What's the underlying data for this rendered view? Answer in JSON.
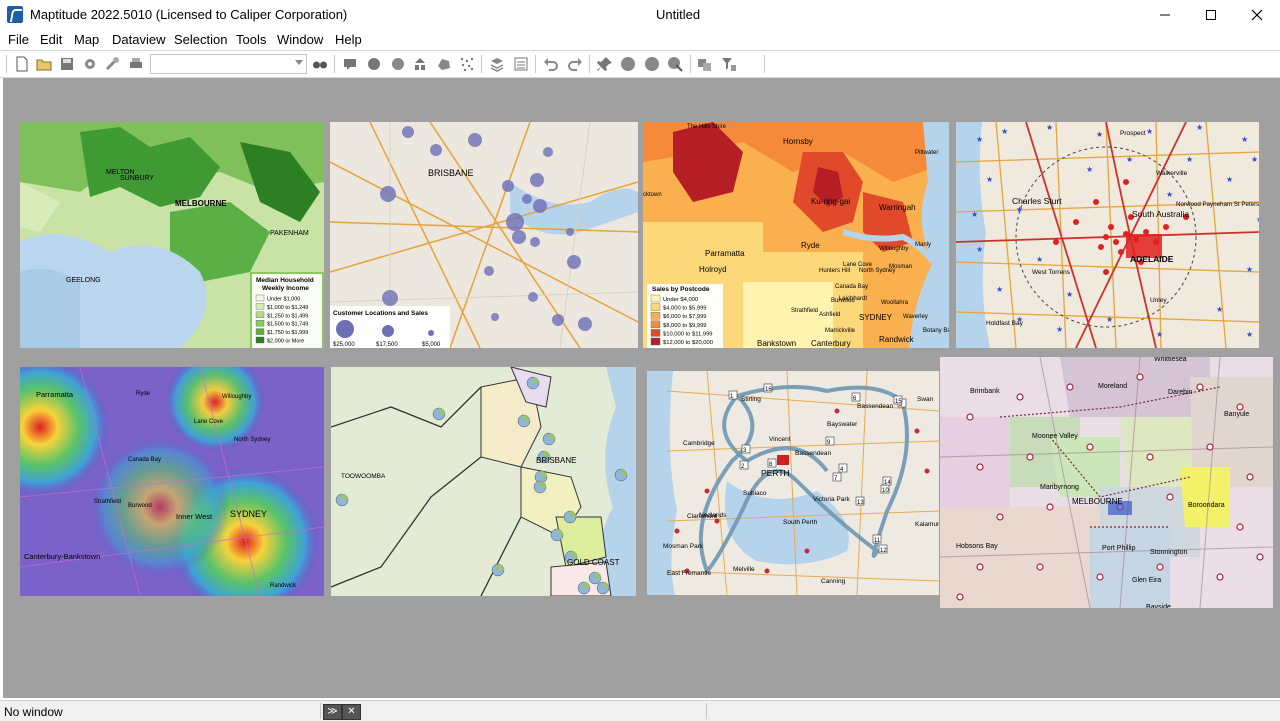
{
  "window": {
    "app_title": "Maptitude 2022.5010 (Licensed to Caliper Corporation)",
    "doc_title": "Untitled",
    "minimize_icon": "minimize-icon",
    "maximize_icon": "maximize-icon",
    "close_icon": "close-icon"
  },
  "menu": [
    "File",
    "Edit",
    "Map",
    "Dataview",
    "Selection",
    "Tools",
    "Window",
    "Help"
  ],
  "toolbar": {
    "combo_value": "",
    "icons": [
      "new-icon",
      "open-icon",
      "save-icon",
      "settings-icon",
      "tools-icon",
      "print-icon",
      "binoculars-icon",
      "map-icon",
      "globe-icon",
      "circle-icon",
      "layers-icon",
      "region-icon",
      "dots-icon",
      "layer-stack-icon",
      "table-icon",
      "undo-icon",
      "redo-icon",
      "pin-icon",
      "point-icon",
      "select-circle-icon",
      "select-icon",
      "selection-tools-icon",
      "filter-icon"
    ]
  },
  "maps": {
    "melbourne_income": {
      "labels": [
        "SUNBURY",
        "MELTON",
        "MELBOURNE",
        "PAKENHAM",
        "GEELONG"
      ],
      "legend_title_1": "Median Household",
      "legend_title_2": "Weekly Income",
      "legend": [
        "Under $1,000",
        "$1,000 to $1,249",
        "$1,250 to $1,499",
        "$1,500 to $1,749",
        "$1,750 to $1,999",
        "$2,000 or More"
      ],
      "legend_colors": [
        "#f1f8e4",
        "#d7ecb8",
        "#b5dd88",
        "#8cc860",
        "#5fae3e",
        "#2d7f24"
      ]
    },
    "brisbane_customers": {
      "city": "BRISBANE",
      "legend_title": "Customer Locations and Sales",
      "legend_values": [
        "$25,000",
        "$17,500",
        "$5,000"
      ]
    },
    "sydney_sales": {
      "labels": [
        "The Hills Shire",
        "Hornsby",
        "Pittwater",
        "Ku-ring-gai",
        "Warringah",
        "Ryde",
        "Parramatta",
        "Holroyd",
        "Manly",
        "Canada Bay",
        "Strathfield",
        "Ashfield",
        "Leichhardt",
        "Woollahra",
        "SYDNEY",
        "Marrickville",
        "Waverley",
        "Randwick",
        "Bankstown",
        "Canterbury",
        "cktown",
        "Hunters Hill",
        "North Sydney",
        "Mosman",
        "Lane Cove",
        "Willoughby",
        "Burwood",
        "Botany Bay"
      ],
      "legend_title": "Sales by Postcode",
      "legend": [
        "Under $4,000",
        "$4,000 to $5,999",
        "$6,000 to $7,999",
        "$8,000 to $9,999",
        "$10,000 to $11,999",
        "$12,000 to $20,000"
      ],
      "legend_colors": [
        "#fff3b0",
        "#fdd87a",
        "#fbb050",
        "#f48a3a",
        "#e04a2a",
        "#b41e24"
      ]
    },
    "adelaide_points": {
      "labels": [
        "Prospect",
        "Walkerville",
        "Charles Sturt",
        "South Australia",
        "Norwood Payneham St Peters",
        "ADELAIDE",
        "West Torrens",
        "Unley",
        "Holdfast Bay"
      ]
    },
    "sydney_heatmap": {
      "labels": [
        "Parramatta",
        "Ryde",
        "Willoughby",
        "Lane Cove",
        "North Sydney",
        "Canada Bay",
        "Strathfield",
        "Burwood",
        "Inner West",
        "SYDNEY",
        "Canterbury-Bankstown",
        "Randwick"
      ]
    },
    "brisbane_pies": {
      "labels": [
        "TOOWOOMBA",
        "BRISBANE",
        "GOLD COAST"
      ]
    },
    "perth_routes": {
      "labels": [
        "Stirling",
        "Bayswater",
        "Bassendean",
        "Swan",
        "Cambridge",
        "Vincent",
        "PERTH",
        "Subiaco",
        "Bassendean",
        "Victoria Park",
        "Claremont",
        "Nedlands",
        "South Perth",
        "Kalamunda",
        "Mosman Park",
        "East Fremantle",
        "Melville",
        "Canning"
      ],
      "stops": [
        "1",
        "2",
        "3",
        "4",
        "5",
        "6",
        "7",
        "8",
        "9",
        "10",
        "11",
        "12",
        "13",
        "14",
        "15",
        "16"
      ]
    },
    "melbourne_regions": {
      "labels": [
        "Whittlesea",
        "Brimbank",
        "Moreland",
        "Darebin",
        "Banyule",
        "Moonee Valley",
        "Maribyrnong",
        "MELBOURNE",
        "Boroondara",
        "Port Phillip",
        "Hobsons Bay",
        "Stonnington",
        "Glen Eira",
        "Bayside"
      ]
    }
  },
  "status": {
    "text": "No window",
    "btn1": "≫",
    "btn2": "✕"
  }
}
